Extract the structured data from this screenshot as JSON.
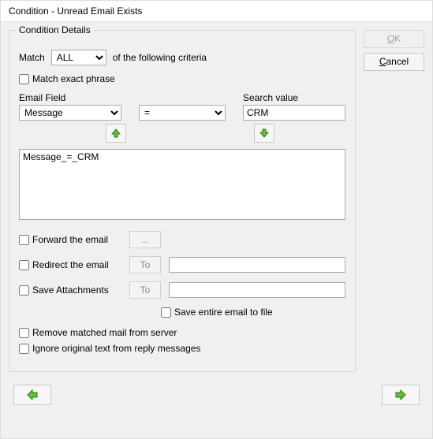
{
  "title": "Condition - Unread Email  Exists",
  "buttons": {
    "ok": "OK",
    "cancel": "Cancel"
  },
  "fieldset_legend": "Condition Details",
  "match_label": "Match",
  "match_mode": "ALL",
  "match_suffix": "of the following criteria",
  "match_exact_phrase": "Match exact phrase",
  "email_field_label": "Email Field",
  "email_field_value": "Message",
  "operator_value": "=",
  "search_value_label": "Search value",
  "search_value": "CRM",
  "criteria_list": [
    "Message_=_CRM"
  ],
  "forward_label": "Forward the email",
  "dots_label": "...",
  "redirect_label": "Redirect the email",
  "to_label": "To",
  "save_attach_label": "Save Attachments",
  "save_entire_label": "Save entire email to file",
  "remove_label": "Remove matched mail from server",
  "ignore_label": "Ignore original text from reply messages"
}
